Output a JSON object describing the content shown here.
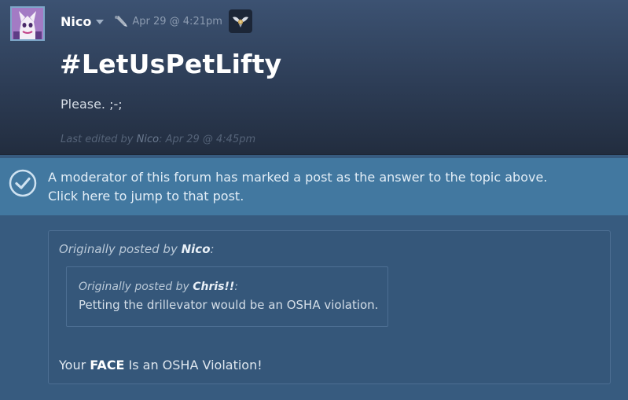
{
  "post": {
    "author": "Nico",
    "timestamp": "Apr 29 @ 4:21pm",
    "title": "#LetUsPetLifty",
    "body": "Please. ;-;",
    "edited_prefix": "Last edited by",
    "edited_by": "Nico",
    "edited_when": ": Apr 29 @ 4:45pm",
    "icons": [
      "avatar",
      "pen-icon",
      "award-badge-icon",
      "chevron-down-icon"
    ]
  },
  "answer_notice": {
    "line1": "A moderator of this forum has marked a post as the answer to the topic above.",
    "line2": "Click here to jump to that post.",
    "icon": "checkmark-circle-icon"
  },
  "reply": {
    "quote_prefix": "Originally posted by",
    "quote_author": "Nico",
    "quote_suffix": ":",
    "inner_quote_prefix": "Originally posted by",
    "inner_quote_author": "Chris!!",
    "inner_quote_suffix": ":",
    "inner_quote_text": "Petting the drillevator would be an OSHA violation.",
    "text_pre": "Your",
    "text_bold": "FACE",
    "text_post": "Is an OSHA Violation!"
  },
  "colors": {
    "post_bg_top": "#3c5272",
    "post_bg_bottom": "#222d3f",
    "answer_bar": "#4278a0",
    "reply_bg": "#35577a",
    "page_bg": "#375b7f"
  }
}
